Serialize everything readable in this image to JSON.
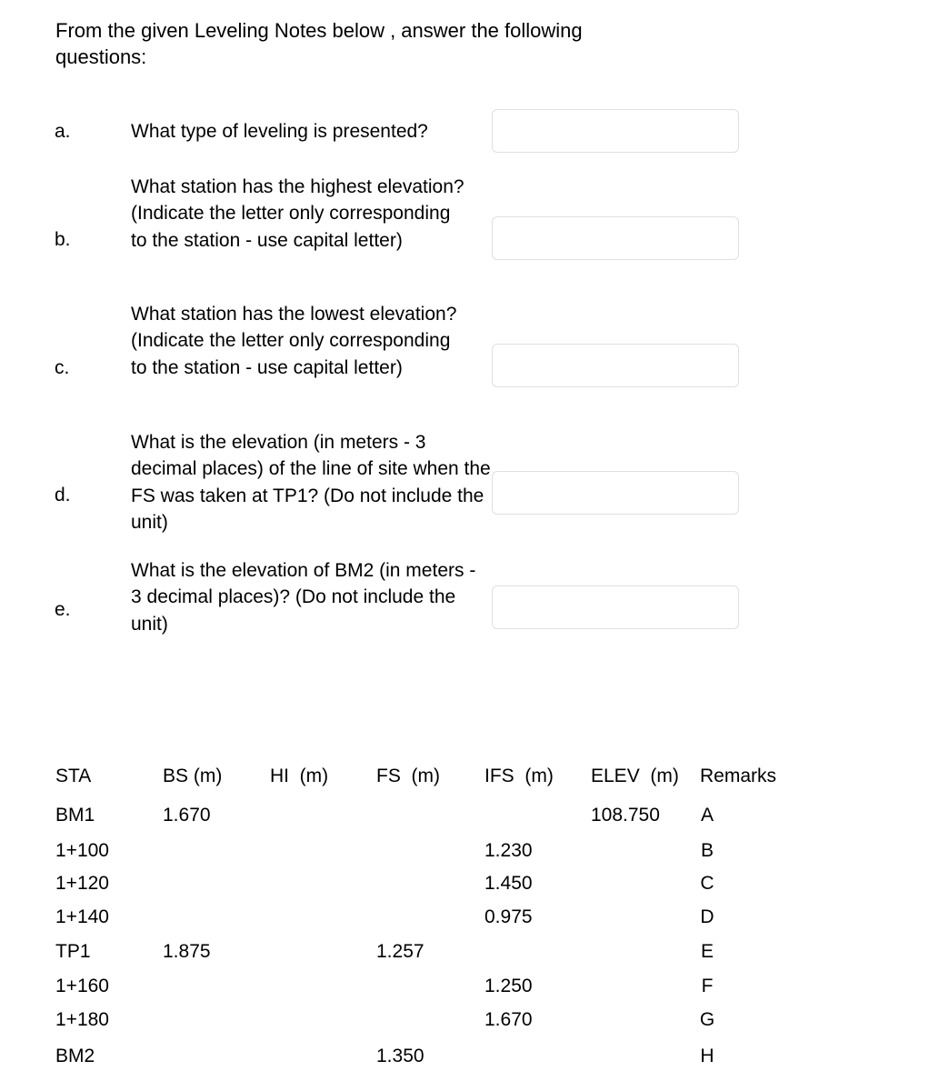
{
  "intro": "From the given Leveling Notes below , answer the  following questions:",
  "questions": [
    {
      "letter": "a.",
      "text": "What type of leveling is presented?",
      "answer": ""
    },
    {
      "letter": "b.",
      "text": "What station has the highest elevation? (Indicate the letter only corresponding to the station - use capital letter)",
      "answer": ""
    },
    {
      "letter": "c.",
      "text": "What station has the lowest elevation? (Indicate the letter only corresponding to the station - use capital letter)",
      "answer": ""
    },
    {
      "letter": "d.",
      "text": "What is the elevation (in meters - 3 decimal places) of the line of site when the FS was taken at TP1? (Do not include the unit)",
      "answer": ""
    },
    {
      "letter": "e.",
      "text": "What is the elevation of BM2 (in meters - 3 decimal places)? (Do not include the unit)",
      "answer": ""
    }
  ],
  "table": {
    "headers": {
      "sta": "STA",
      "bs": "BS (m)",
      "hi": "HI  (m)",
      "fs": "FS  (m)",
      "ifs": "IFS  (m)",
      "elev": "ELEV  (m)",
      "remarks": "Remarks"
    },
    "rows": [
      {
        "sta": "BM1",
        "bs": "1.670",
        "hi": "",
        "fs": "",
        "ifs": "",
        "elev": "108.750",
        "remarks": "A"
      },
      {
        "sta": "1+100",
        "bs": "",
        "hi": "",
        "fs": "",
        "ifs": "1.230",
        "elev": "",
        "remarks": "B"
      },
      {
        "sta": "1+120",
        "bs": "",
        "hi": "",
        "fs": "",
        "ifs": "1.450",
        "elev": "",
        "remarks": "C"
      },
      {
        "sta": "1+140",
        "bs": "",
        "hi": "",
        "fs": "",
        "ifs": "0.975",
        "elev": "",
        "remarks": "D"
      },
      {
        "sta": "TP1",
        "bs": "1.875",
        "hi": "",
        "fs": "1.257",
        "ifs": "",
        "elev": "",
        "remarks": "E"
      },
      {
        "sta": "1+160",
        "bs": "",
        "hi": "",
        "fs": "",
        "ifs": "1.250",
        "elev": "",
        "remarks": "F"
      },
      {
        "sta": "1+180",
        "bs": "",
        "hi": "",
        "fs": "",
        "ifs": "1.670",
        "elev": "",
        "remarks": "G"
      },
      {
        "sta": "BM2",
        "bs": "",
        "hi": "",
        "fs": "1.350",
        "ifs": "",
        "elev": "",
        "remarks": "H"
      }
    ]
  }
}
